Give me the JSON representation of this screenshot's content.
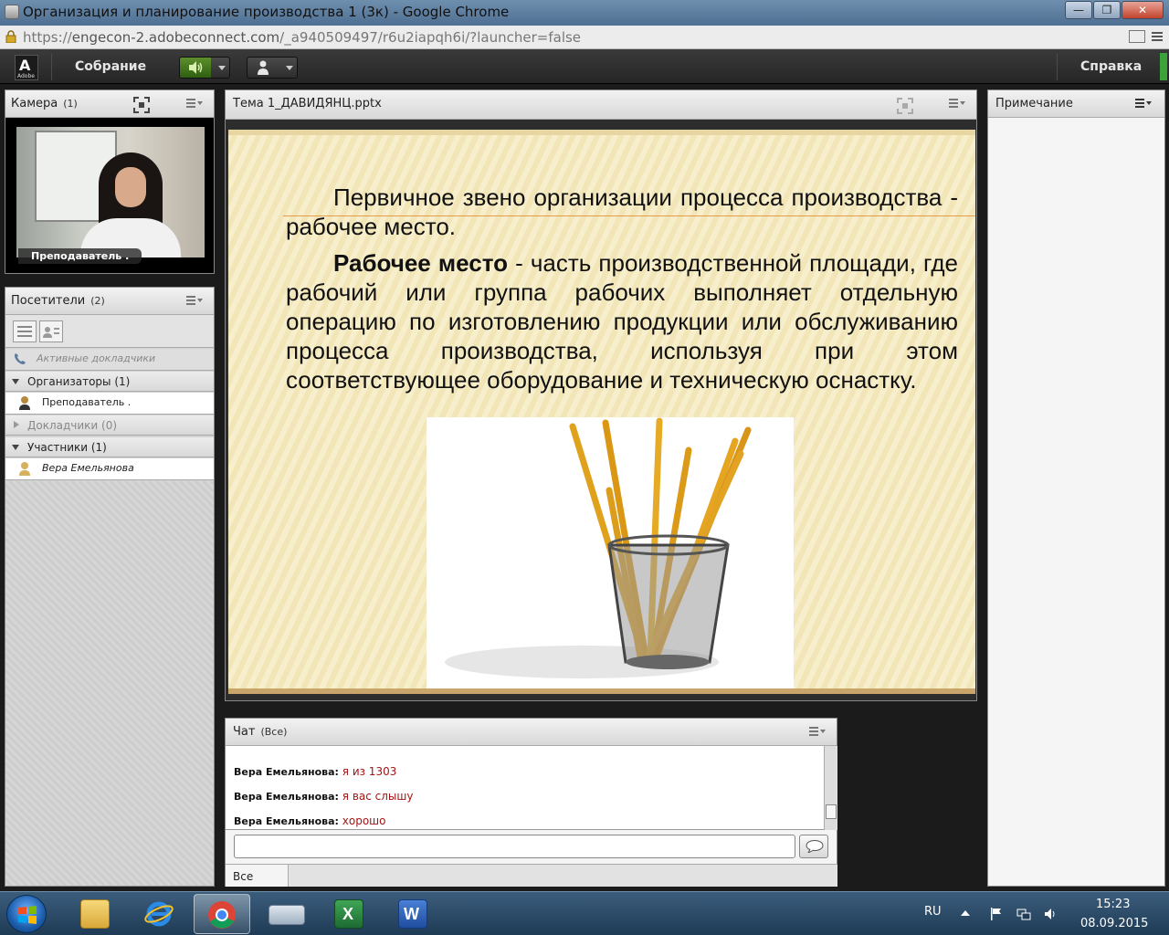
{
  "window": {
    "title": "Организация и планирование производства 1 (3к) - Google Chrome",
    "minimize_label": "—",
    "restore_label": "❐",
    "close_label": "✕"
  },
  "address_bar": {
    "scheme": "https://",
    "host": "engecon-2.adobeconnect.com",
    "path": "/_a940509497/r6u2iapqh6i/?launcher=false"
  },
  "toolbar": {
    "logo_mark": "A",
    "logo_text": "Adobe",
    "meeting_label": "Собрание",
    "help_label": "Справка"
  },
  "camera_pod": {
    "title": "Камера",
    "count": "(1)",
    "video_label": "Преподаватель ."
  },
  "attendees_pod": {
    "title": "Посетители",
    "count": "(2)",
    "active_speakers": "Активные докладчики",
    "groups": [
      {
        "label": "Организаторы (1)",
        "members": [
          "Преподаватель ."
        ]
      },
      {
        "label": "Докладчики (0)",
        "members": []
      },
      {
        "label": "Участники (1)",
        "members": [
          "Вера Емельянова"
        ]
      }
    ]
  },
  "share_pod": {
    "title": "Тема 1_ДАВИДЯНЦ.pptx",
    "slide": {
      "paragraph1": "Первичное звено организации процесса производства - рабочее место.",
      "term": "Рабочее место",
      "paragraph2_rest": " - часть производственной площади, где рабочий или группа рабочих выполняет отдельную операцию по изготовлению продукции или обслуживанию процесса производства, используя при этом соответствующее оборудование и техническую оснастку.",
      "image": "pencils-in-mesh-cup"
    }
  },
  "note_pod": {
    "title": "Примечание"
  },
  "chat_pod": {
    "title": "Чат",
    "scope": "(Все)",
    "messages": [
      {
        "sender": "Вера Емельянова:",
        "text": "я из 1303"
      },
      {
        "sender": "Вера Емельянова:",
        "text": "я вас слышу"
      },
      {
        "sender": "Вера Емельянова:",
        "text": "хорошо"
      }
    ],
    "input_value": "",
    "tab_label": "Все"
  },
  "taskbar": {
    "apps": [
      "file-explorer",
      "internet-explorer",
      "google-chrome",
      "on-screen-keyboard",
      "microsoft-excel",
      "microsoft-word"
    ],
    "language": "RU",
    "time": "15:23",
    "date": "08.09.2015"
  },
  "colors": {
    "chat_text": "#a31515",
    "slide_rule": "#e59b49",
    "audio_on": "#5e8f2c"
  }
}
